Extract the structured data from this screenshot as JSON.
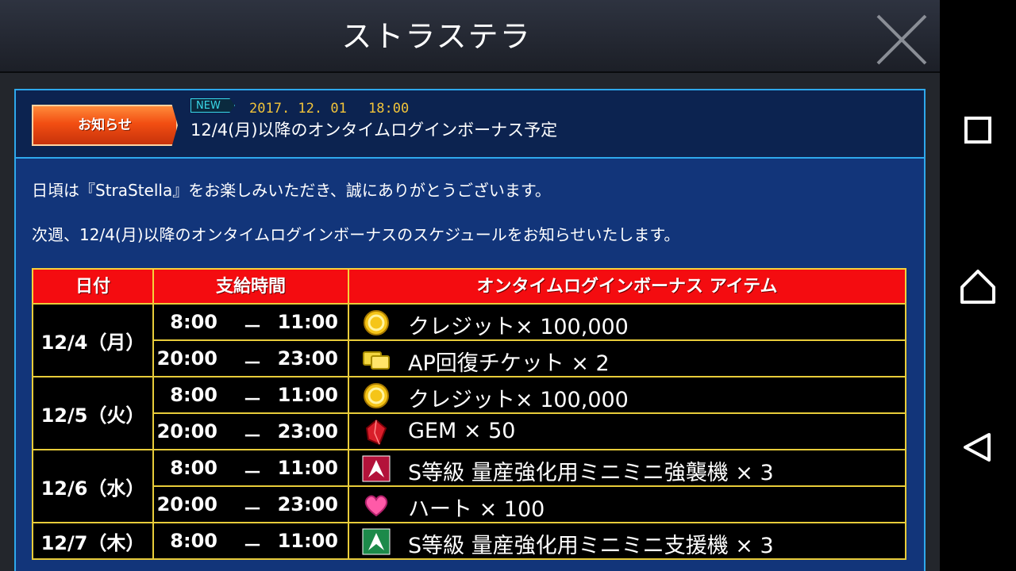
{
  "app": {
    "title": "ストラステラ"
  },
  "notice": {
    "category": "お知らせ",
    "new_label": "NEW",
    "date": "2017. 12. 01　 18:00",
    "title": "12/4(月)以降のオンタイムログインボーナス予定",
    "body": [
      "日頃は『StraStella』をお楽しみいただき、誠にありがとうございます。",
      "次週、12/4(月)以降のオンタイムログインボーナスのスケジュールをお知らせいたします。"
    ]
  },
  "table": {
    "headers": [
      "日付",
      "支給時間",
      "オンタイムログインボーナス アイテム"
    ],
    "days": [
      {
        "date": "12/4（月）",
        "slots": [
          {
            "start": "8:00",
            "end": "11:00",
            "icon": "credit-coin-icon",
            "item": "クレジット× 100,000"
          },
          {
            "start": "20:00",
            "end": "23:00",
            "icon": "ap-ticket-icon",
            "item": "AP回復チケット × 2"
          }
        ]
      },
      {
        "date": "12/5（火）",
        "slots": [
          {
            "start": "8:00",
            "end": "11:00",
            "icon": "credit-coin-icon",
            "item": "クレジット× 100,000"
          },
          {
            "start": "20:00",
            "end": "23:00",
            "icon": "gem-icon",
            "item": "GEM × 50"
          }
        ]
      },
      {
        "date": "12/6（水）",
        "slots": [
          {
            "start": "8:00",
            "end": "11:00",
            "icon": "assault-unit-icon",
            "item": "S等級 量産強化用ミニミニ強襲機 × 3"
          },
          {
            "start": "20:00",
            "end": "23:00",
            "icon": "heart-icon",
            "item": "ハート × 100"
          }
        ]
      },
      {
        "date": "12/7（木）",
        "slots": [
          {
            "start": "8:00",
            "end": "11:00",
            "icon": "support-unit-icon",
            "item": "S等級 量産強化用ミニミニ支援機 × 3"
          }
        ]
      }
    ],
    "time_separator": "－"
  },
  "colors": {
    "header_red": "#f40c10",
    "grid_yellow": "#e8cc3a",
    "panel_blue": "#12357a",
    "border_cyan": "#2ea8ec",
    "date_gold": "#f2c43a"
  },
  "nav": {
    "icons": [
      "recents-icon",
      "home-icon",
      "back-icon"
    ]
  }
}
